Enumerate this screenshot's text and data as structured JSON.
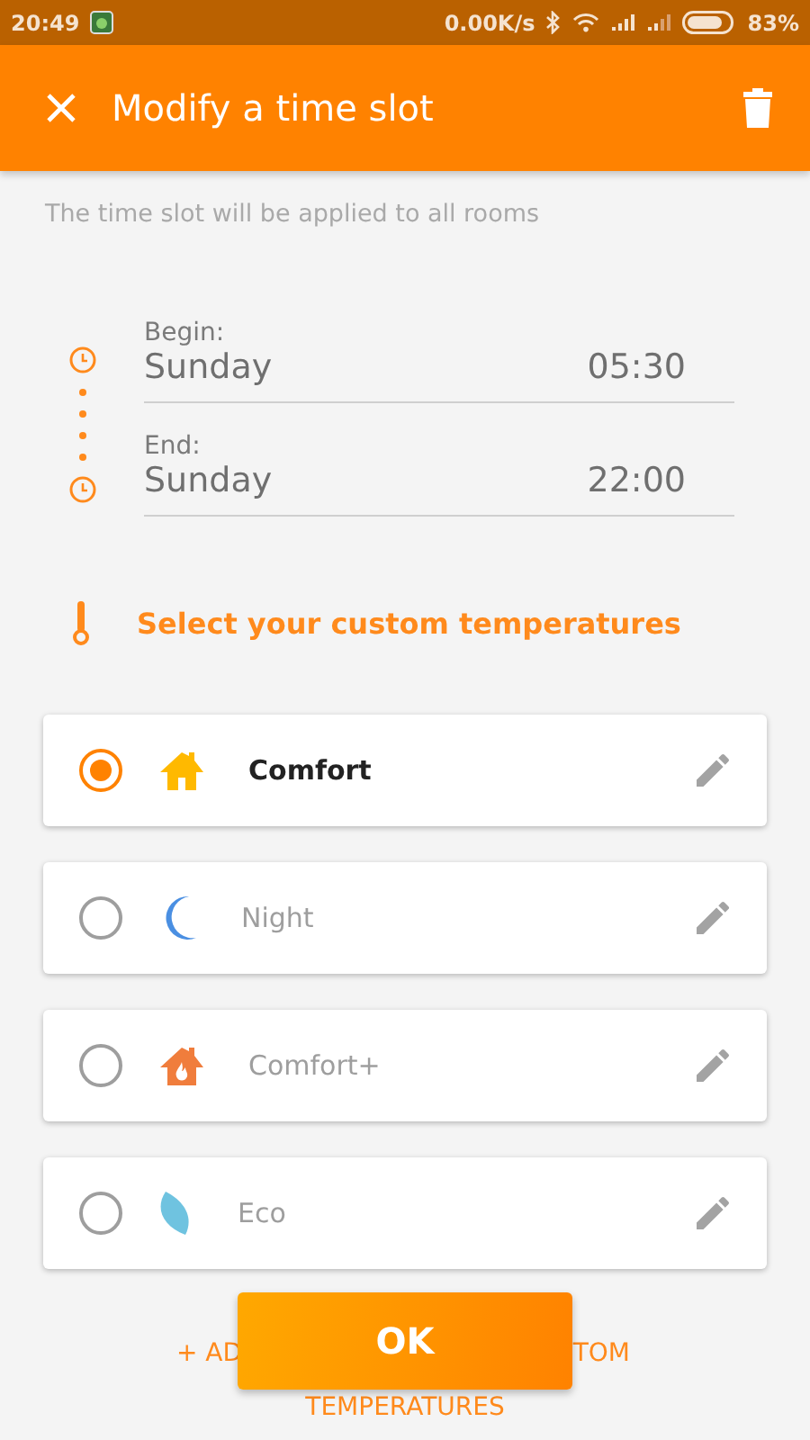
{
  "status_bar": {
    "time": "20:49",
    "network_speed": "0.00K/s",
    "battery": "83%"
  },
  "app_bar": {
    "title": "Modify a time slot"
  },
  "subtitle": "The time slot will be applied to all rooms",
  "slot": [
    {
      "label": "Begin:",
      "day": "Sunday",
      "time": "05:30"
    },
    {
      "label": "End:",
      "day": "Sunday",
      "time": "22:00"
    }
  ],
  "section_title": "Select your custom temperatures",
  "temperatures": [
    {
      "name": "Comfort",
      "kind": "comfort",
      "selected": true
    },
    {
      "name": "Night",
      "kind": "night",
      "selected": false
    },
    {
      "name": "Comfort+",
      "kind": "comfortplus",
      "selected": false
    },
    {
      "name": "Eco",
      "kind": "eco",
      "selected": false
    }
  ],
  "add_link": {
    "parts": [
      "+ AD",
      "TOM"
    ],
    "second_line": "TEMPERATURES"
  },
  "ok_button": "OK"
}
